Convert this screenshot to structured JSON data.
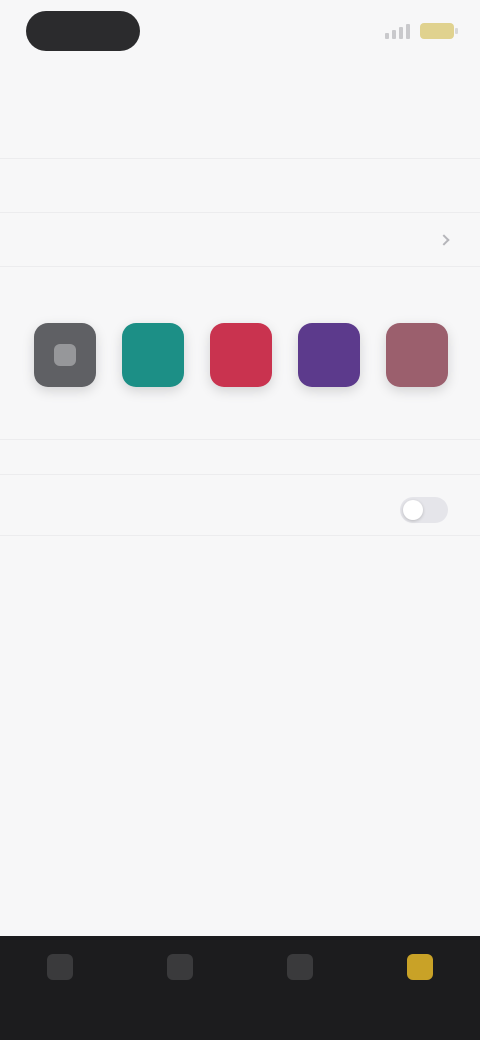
{
  "colors": {
    "accent": "#c9a227",
    "swatches": [
      "#5f6064",
      "#1c8f86",
      "#c9334f",
      "#5c3a8c",
      "#9b5f6d"
    ]
  },
  "header": {
    "title": "",
    "subtitle": ""
  },
  "rows": {
    "option_label": "",
    "default_label": "",
    "default_value": ""
  },
  "sections": {
    "theme_title": "",
    "theme_text": "",
    "swatch_caption": "",
    "display_title": "",
    "display_text": "",
    "adaptive_title": "",
    "adaptive_text": "",
    "footer_label": ""
  },
  "tabs": [
    {
      "icon": "home-icon",
      "label": ""
    },
    {
      "icon": "search-icon",
      "label": ""
    },
    {
      "icon": "library-icon",
      "label": ""
    },
    {
      "icon": "settings-icon",
      "label": ""
    }
  ]
}
